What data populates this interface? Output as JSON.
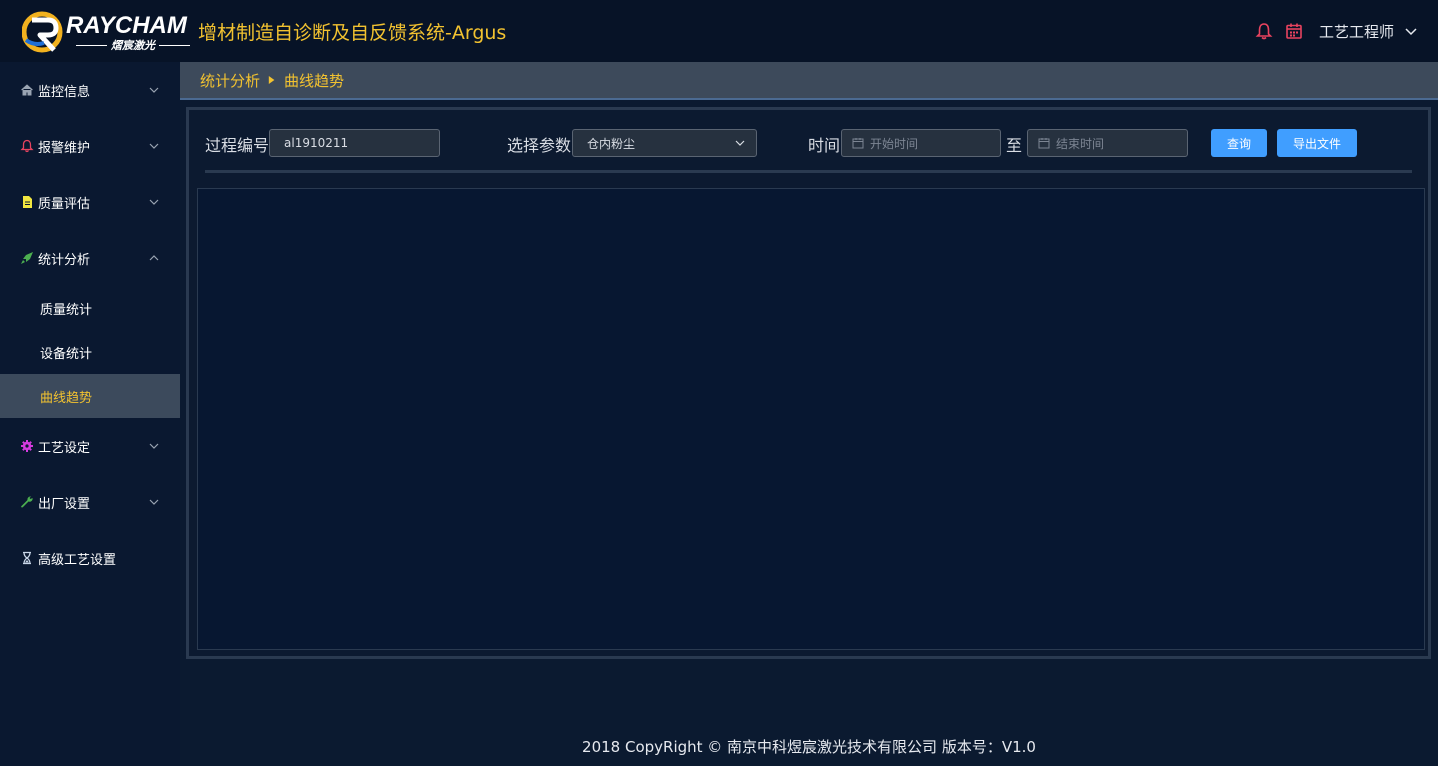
{
  "header": {
    "brand": "RAYCHAM",
    "brand_sub": "熠宸激光",
    "title": "增材制造自诊断及自反馈系统-Argus",
    "user": "工艺工程师",
    "accent_color": "#f2c230",
    "icon_color": "#e8435f"
  },
  "sidebar": {
    "items": [
      {
        "label": "监控信息",
        "icon": "home-icon"
      },
      {
        "label": "报警维护",
        "icon": "bell-icon"
      },
      {
        "label": "质量评估",
        "icon": "document-icon"
      },
      {
        "label": "统计分析",
        "icon": "rocket-icon",
        "expanded": true
      },
      {
        "label": "工艺设定",
        "icon": "gear-icon"
      },
      {
        "label": "出厂设置",
        "icon": "wrench-icon"
      },
      {
        "label": "高级工艺设置",
        "icon": "hourglass-icon"
      }
    ],
    "sub_items": [
      {
        "label": "质量统计"
      },
      {
        "label": "设备统计"
      },
      {
        "label": "曲线趋势",
        "active": true
      }
    ]
  },
  "breadcrumb": {
    "parent": "统计分析",
    "current": "曲线趋势"
  },
  "filters": {
    "process_label": "过程编号",
    "process_value": "al1910211",
    "param_label": "选择参数",
    "param_value": "仓内粉尘",
    "time_label": "时间",
    "start_placeholder": "开始时间",
    "to_label": "至",
    "end_placeholder": "结束时间",
    "query_button": "查询",
    "export_button": "导出文件"
  },
  "footer": {
    "text": "2018 CopyRight © 南京中科煜宸激光技术有限公司 版本号：V1.0"
  }
}
